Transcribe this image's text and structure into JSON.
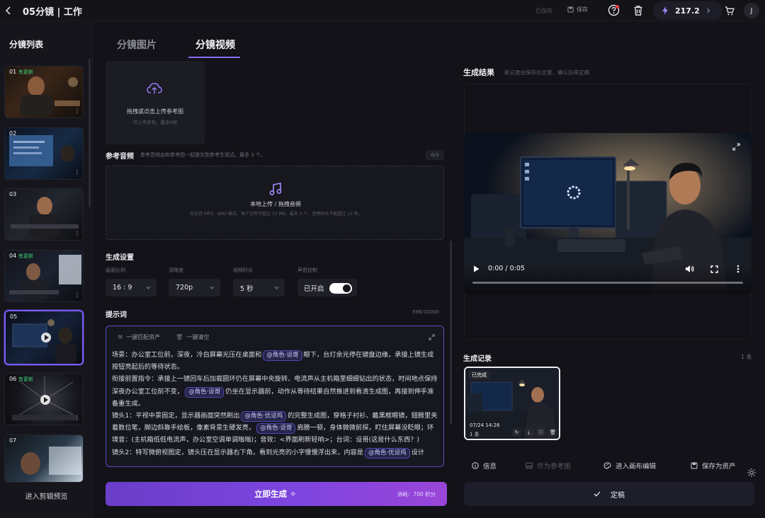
{
  "topbar": {
    "title": "05分镜 | 工作",
    "saved_label": "已保存",
    "save_label": "保存",
    "credits": "217.2",
    "avatar_initial": "J"
  },
  "sidebar": {
    "title": "分镜列表",
    "shots": [
      {
        "num": "01",
        "badge": "有更新"
      },
      {
        "num": "02",
        "badge": ""
      },
      {
        "num": "03",
        "badge": ""
      },
      {
        "num": "04",
        "badge": "有更新"
      },
      {
        "num": "05",
        "badge": ""
      },
      {
        "num": "06",
        "badge": "有更新"
      },
      {
        "num": "07",
        "badge": ""
      }
    ],
    "preview_label": "进入剪辑预览"
  },
  "tabs": {
    "image": "分镜图片",
    "video": "分镜视频"
  },
  "upload": {
    "main": "拖拽或点击上传参考图",
    "sub": "可上传多张，最多6张"
  },
  "audio": {
    "title": "参考音频",
    "hint": "参考音频会和参考图一起提交到参考生视式。最多 3 个。",
    "counter": "0/3",
    "main": "本地上传 / 拖拽音频",
    "sub": "仅支持 MP3、WAV 格式，每个文件不超过 15 MB，最多 3 个，音频时长不能超过 15 秒。"
  },
  "settings": {
    "title": "生成设置",
    "ratio_label": "画面比例",
    "ratio_value": "16 : 9",
    "res_label": "清晰度",
    "res_value": "720p",
    "dur_label": "视频时长",
    "dur_value": "5 秒",
    "audio_label": "声音控制",
    "audio_value": "已开启",
    "audio_on": true
  },
  "prompt": {
    "title": "提示词",
    "counter": "598/10000",
    "tool_match": "一键匹配资产",
    "tool_clear": "一键清空",
    "segments": [
      {
        "t": "场景：办公室工位前，深夜，冷白屏幕光压在桌面和"
      },
      {
        "chip": "@角色·设哥"
      },
      {
        "t": "眼下，台灯余光停在键盘边缘，承接上镜生成按钮亮起后的等待状态。"
      },
      {
        "br": true
      },
      {
        "t": "衔接前置指令：承接上一镜回车后加载圆环仍在屏幕中央旋转、电流声从主机箱里细细钻出的状态，时间地点保持深夜办公室工位前不变，"
      },
      {
        "chip": "@角色·设哥"
      },
      {
        "t": "仍坐在显示器前，动作从等待结果自然推进到看清生成图，再接到伸手准备重生成。"
      },
      {
        "br": true
      },
      {
        "t": "镜头1：平视中景固定，显示器画面突然刷出"
      },
      {
        "chip": "@角色·优设鸡"
      },
      {
        "t": "的完整生成图，穿格子衬衫、戴黑框眼镜，翅膀里夹着数位笔，脚边斜靠手绘板，像素背景生硬发亮，"
      },
      {
        "chip": "@角色·设哥"
      },
      {
        "t": "肩膀一顿，身体微微前探，盯住屏幕没眨眼；环境音：(主机箱低低电流声，办公室空调单调嗡嗡)；音效：<界面刷新轻响>；台词：设哥(这是什么东西？)"
      },
      {
        "br": true
      },
      {
        "t": "镜头2：特写微俯视图定，镜头压在显示器右下角，看到光亮的小字慢慢浮出来，内容是"
      },
      {
        "chip": "@角色·优设鸡"
      },
      {
        "t": "设计"
      }
    ]
  },
  "generate": {
    "label": "立即生成",
    "cost": "消耗：700 积分"
  },
  "result": {
    "title": "生成结果",
    "hint": "新记录会保存在这里，确认后再定稿",
    "time": "0:00 / 0:05"
  },
  "records": {
    "title": "生成记录",
    "count": "1 条",
    "status": "已完成",
    "timestamp": "07/24 14:26",
    "items": "1 条"
  },
  "actions": {
    "info": "信息",
    "as_ref": "作为参考图",
    "canvas": "进入画布编辑",
    "save_asset": "保存为资产"
  },
  "confirm_label": "定稿",
  "colors": {
    "accent": "#7b5cf0",
    "success": "#3fd07a",
    "background": "#121218"
  }
}
